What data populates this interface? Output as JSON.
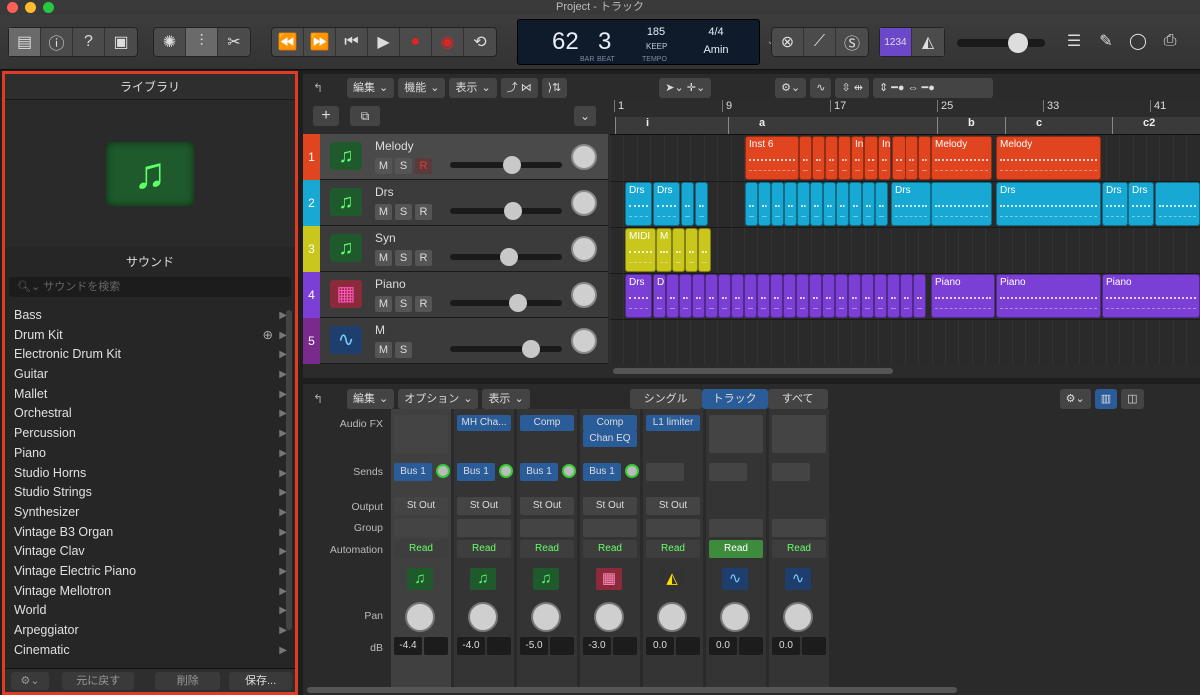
{
  "window": {
    "title": "Project - トラック"
  },
  "lcd": {
    "bar": "62",
    "beat": "3",
    "bar_label": "BAR",
    "beat_label": "BEAT",
    "tempo": "185",
    "tempo_mode": "KEEP",
    "tempo_label": "TEMPO",
    "sig": "4/4",
    "key": "Amin"
  },
  "toolbar": {
    "count_in": "1234"
  },
  "library": {
    "title": "ライブラリ",
    "sound_label": "サウンド",
    "search_placeholder": "サウンドを検索",
    "items": [
      {
        "label": "Bass",
        "arrow": true
      },
      {
        "label": "Drum Kit",
        "arrow": true,
        "download": true
      },
      {
        "label": "Electronic Drum Kit",
        "arrow": true
      },
      {
        "label": "Guitar",
        "arrow": true
      },
      {
        "label": "Mallet",
        "arrow": true
      },
      {
        "label": "Orchestral",
        "arrow": true
      },
      {
        "label": "Percussion",
        "arrow": true
      },
      {
        "label": "Piano",
        "arrow": true
      },
      {
        "label": "Studio Horns",
        "arrow": true
      },
      {
        "label": "Studio Strings",
        "arrow": true
      },
      {
        "label": "Synthesizer",
        "arrow": true
      },
      {
        "label": "Vintage B3 Organ",
        "arrow": true
      },
      {
        "label": "Vintage Clav",
        "arrow": true
      },
      {
        "label": "Vintage Electric Piano",
        "arrow": true
      },
      {
        "label": "Vintage Mellotron",
        "arrow": true
      },
      {
        "label": "World",
        "arrow": true
      },
      {
        "label": "Arpeggiator",
        "arrow": true
      },
      {
        "label": "Cinematic",
        "arrow": true
      }
    ],
    "revert_label": "元に戻す",
    "delete_label": "削除",
    "save_label": "保存..."
  },
  "tracks_menu": {
    "edit": "編集",
    "function": "機能",
    "view": "表示"
  },
  "ruler": {
    "bars": [
      "1",
      "9",
      "17",
      "25",
      "33",
      "41"
    ],
    "markers": [
      "i",
      "a",
      "b",
      "c",
      "c2"
    ]
  },
  "tracks": [
    {
      "num": "1",
      "name": "Melody",
      "color": "#e0451f",
      "buttons": [
        "M",
        "S",
        "R"
      ],
      "icon": "music-note-icon"
    },
    {
      "num": "2",
      "name": "Drs",
      "color": "#17a9d3",
      "buttons": [
        "M",
        "S",
        "R"
      ],
      "icon": "music-note-icon"
    },
    {
      "num": "3",
      "name": "Syn",
      "color": "#c9c71b",
      "buttons": [
        "M",
        "S",
        "R"
      ],
      "icon": "music-note-icon"
    },
    {
      "num": "4",
      "name": "Piano",
      "color": "#7b3fd6",
      "buttons": [
        "M",
        "S",
        "R"
      ],
      "icon": "piano-icon"
    },
    {
      "num": "5",
      "name": "M",
      "color": "#7a2a8c",
      "buttons": [
        "M",
        "S"
      ],
      "icon": "waveform-icon"
    }
  ],
  "regions": {
    "melody": [
      "Inst 6",
      "Inst",
      "Inst",
      "Melody",
      "Melody"
    ],
    "drs": [
      "Drs",
      "Drs",
      "Drs",
      "Drs",
      "Drs",
      "Drs"
    ],
    "syn": [
      "MIDI",
      "M"
    ],
    "piano": [
      "Drs",
      "D",
      "Piano",
      "Piano",
      "Piano"
    ]
  },
  "mixer_menu": {
    "edit": "編集",
    "options": "オプション",
    "view": "表示",
    "single": "シングル",
    "tracks": "トラック",
    "all": "すべて"
  },
  "mixer": {
    "labels": {
      "audio_fx": "Audio FX",
      "sends": "Sends",
      "output": "Output",
      "group": "Group",
      "automation": "Automation",
      "pan": "Pan",
      "db": "dB"
    },
    "strips": [
      {
        "fx": [],
        "send": "Bus 1",
        "output": "St Out",
        "automation": "Read",
        "db": "-4.4",
        "icon": "music-note-icon"
      },
      {
        "fx": [
          "MH Cha..."
        ],
        "send": "Bus 1",
        "output": "St Out",
        "automation": "Read",
        "db": "-4.0",
        "icon": "music-note-icon"
      },
      {
        "fx": [
          "Comp"
        ],
        "send": "Bus 1",
        "output": "St Out",
        "automation": "Read",
        "db": "-5.0",
        "icon": "music-note-icon"
      },
      {
        "fx": [
          "Comp",
          "Chan EQ"
        ],
        "send": "Bus 1",
        "output": "St Out",
        "automation": "Read",
        "db": "-3.0",
        "icon": "piano-icon"
      },
      {
        "fx": [
          "L1 limiter"
        ],
        "send": "",
        "output": "St Out",
        "automation": "Read",
        "db": "0.0",
        "icon": "metronome-icon"
      },
      {
        "fx": [],
        "send": "",
        "output": "",
        "automation": "Read",
        "db": "0.0",
        "icon": "waveform-icon"
      },
      {
        "fx": [],
        "send": "",
        "output": "",
        "automation": "Read",
        "db": "0.0",
        "icon": "waveform-icon"
      }
    ]
  }
}
